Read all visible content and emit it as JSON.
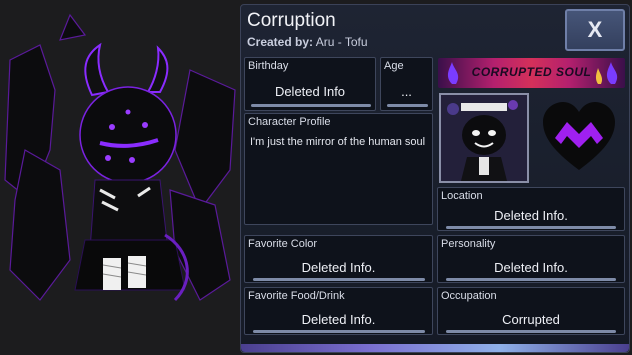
{
  "profile": {
    "title": "Corruption",
    "created_by_label": "Created by:",
    "created_by_value": "Aru - Tofu",
    "close_label": "X",
    "banner_text": "CORRUPTED SOUL"
  },
  "fields": {
    "birthday": {
      "label": "Birthday",
      "value": "Deleted Info"
    },
    "age": {
      "label": "Age",
      "value": "..."
    },
    "character_profile": {
      "label": "Character Profile",
      "value": "I'm just the mirror of the human soul"
    },
    "location": {
      "label": "Location",
      "value": "Deleted Info."
    },
    "favorite_color": {
      "label": "Favorite Color",
      "value": "Deleted Info."
    },
    "personality": {
      "label": "Personality",
      "value": "Deleted Info."
    },
    "favorite_food": {
      "label": "Favorite Food/Drink",
      "value": "Deleted Info."
    },
    "occupation": {
      "label": "Occupation",
      "value": "Corrupted"
    }
  },
  "icons": {
    "portrait": "character-portrait-image",
    "heart": "corrupted-heart-icon",
    "close": "close-icon"
  },
  "colors": {
    "accent_purple": "#7b2cff",
    "banner_pink": "#d4305a",
    "panel_bg": "#151a26"
  }
}
